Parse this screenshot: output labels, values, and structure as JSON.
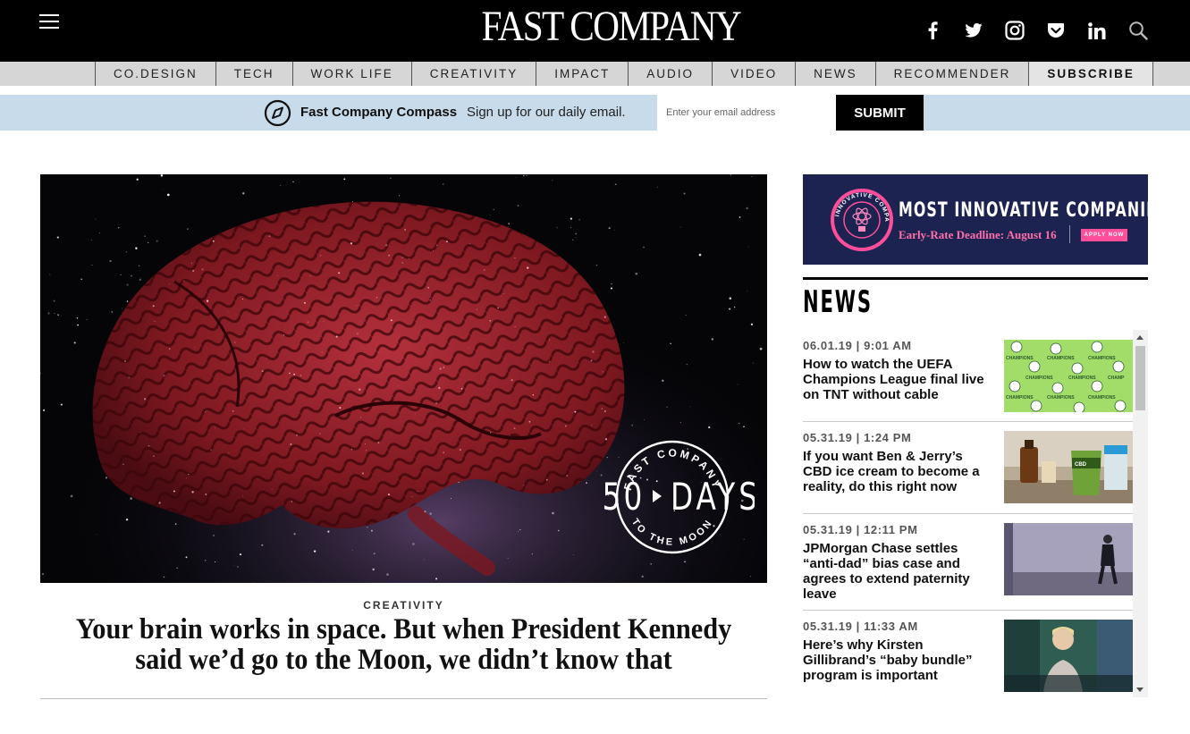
{
  "header": {
    "logo_text": "FAST COMPANY",
    "social_icons": [
      "facebook-icon",
      "twitter-icon",
      "instagram-icon",
      "pocket-icon",
      "linkedin-icon",
      "search-icon"
    ]
  },
  "nav": {
    "items": [
      "CO.DESIGN",
      "TECH",
      "WORK LIFE",
      "CREATIVITY",
      "IMPACT",
      "AUDIO",
      "VIDEO",
      "NEWS",
      "RECOMMENDER",
      "SUBSCRIBE"
    ]
  },
  "compass": {
    "brand": "Fast Company Compass",
    "text": "Sign up for our daily email.",
    "email_placeholder": "Enter your email address",
    "email_value": "",
    "submit_label": "SUBMIT"
  },
  "hero": {
    "badge_top": "FAST COMPANY",
    "badge_main_left": "50",
    "badge_main_right": "DAYS",
    "badge_bottom": "TO THE MOON",
    "category": "CREATIVITY",
    "title": "Your brain works in space. But when President Kennedy said we’d go to the Moon, we didn’t know that"
  },
  "ad": {
    "title": "MOST INNOVATIVE COMPANIES",
    "deadline": "Early-Rate Deadline: August 16",
    "apply": "APPLY NOW",
    "seal_text": "MOST INNOVATIVE COMPANIES"
  },
  "news": {
    "heading": "NEWS",
    "items": [
      {
        "date": "06.01.19 | 9:01 AM",
        "title": "How to watch the UEFA Champions League final live on TNT without cable"
      },
      {
        "date": "05.31.19 | 1:24 PM",
        "title": "If you want Ben & Jerry’s CBD ice cream to become a reality, do this right now"
      },
      {
        "date": "05.31.19 | 12:11 PM",
        "title": "JPMorgan Chase settles “anti-dad” bias case and agrees to extend paternity leave"
      },
      {
        "date": "05.31.19 | 11:33 AM",
        "title": "Here’s why Kirsten Gillibrand’s “baby bundle” program is important"
      }
    ]
  },
  "colors": {
    "header_bg": "#000000",
    "nav_bg": "#d6d6d6",
    "compass_bg": "#c7dbeb",
    "ad_bg": "#1c2350",
    "ad_accent": "#ff4f9a"
  }
}
